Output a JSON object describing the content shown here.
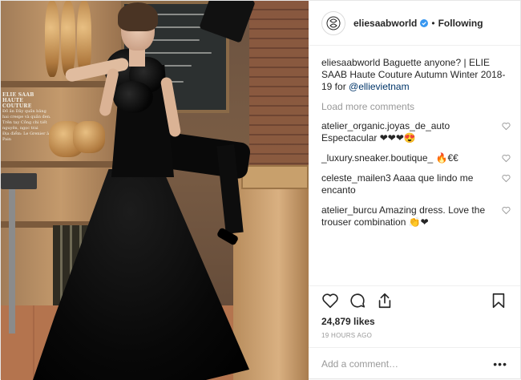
{
  "photo": {
    "sign_title": "ELIE SAAB HAUTE COUTURE",
    "sign_body": "Đồ ăn Dây quần bảng hai crespe và quần đen. Trên tay Cồng chi tiết nguyên, ngọc trai",
    "sign_location": "Địa điểm: Le Grenier à Pain"
  },
  "header": {
    "username": "eliesaabworld",
    "separator": "•",
    "follow_status": "Following"
  },
  "caption": {
    "username": "eliesaabworld",
    "text": "Baguette anyone? | ELIE SAAB Haute Couture Autumn Winter 2018-19 for",
    "mention": "@ellievietnam"
  },
  "load_more": "Load more comments",
  "comments": [
    {
      "username": "atelier_organic.joyas_de_auto",
      "text": "Espectacular ❤❤❤😍"
    },
    {
      "username": "_luxury.sneaker.boutique_",
      "text": "🔥€€"
    },
    {
      "username": "celeste_mailen3",
      "text": "Aaaa que lindo me encanto"
    },
    {
      "username": "atelier_burcu",
      "text": "Amazing dress. Love the trouser combination 👏❤"
    }
  ],
  "likes": "24,879 likes",
  "timestamp": "19 HOURS AGO",
  "add_comment": {
    "placeholder": "Add a comment…",
    "more": "•••"
  },
  "colors": {
    "accent_blue": "#3897f0",
    "mention": "#003569",
    "muted": "#999999"
  }
}
